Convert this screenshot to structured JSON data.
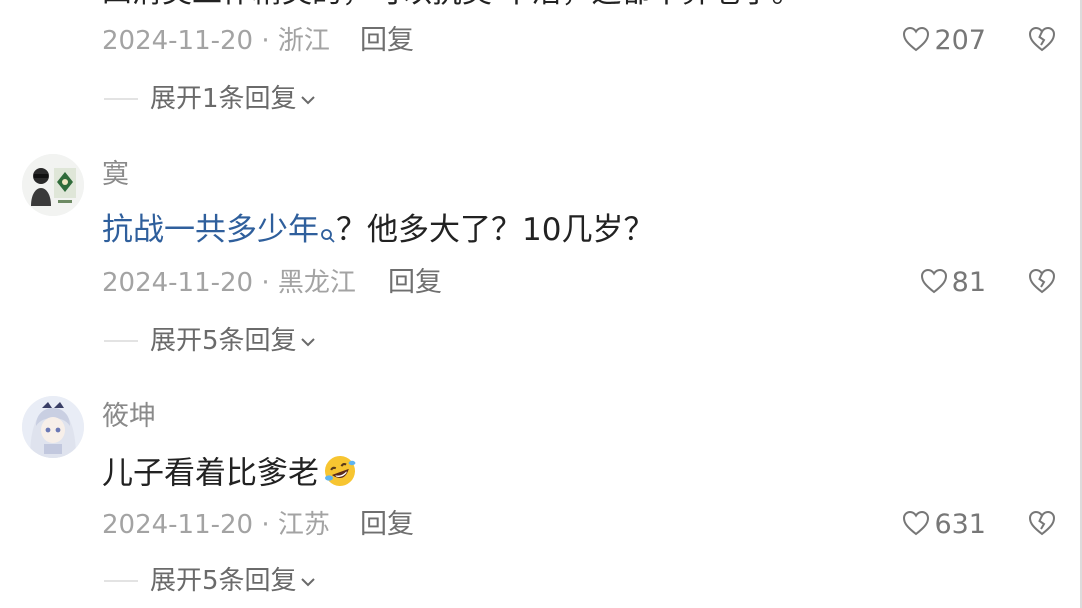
{
  "top_partial": {
    "text": "四清类工作精英的，可以抗美 不活，这都不算老了。"
  },
  "comments": [
    {
      "id": "c0",
      "date_location": "2024-11-20 · 浙江",
      "reply_label": "回复",
      "like_count": "207",
      "expand_label": "展开1条回复"
    },
    {
      "id": "c1",
      "username": "寞",
      "content_link": "抗战一共多少年",
      "content_rest": "？他多大了？10几岁？",
      "date_location": "2024-11-20 · 黑龙江",
      "reply_label": "回复",
      "like_count": "81",
      "expand_label": "展开5条回复"
    },
    {
      "id": "c2",
      "username": "筱坤",
      "content": "儿子看着比爹老",
      "emoji": "rolling-on-floor-laughing",
      "date_location": "2024-11-20 · 江苏",
      "reply_label": "回复",
      "like_count": "631",
      "expand_label": "展开5条回复"
    }
  ],
  "colors": {
    "link": "#2f5f9c",
    "meta": "#a3a3a3",
    "text": "#222222"
  },
  "icons": {
    "like": "heart-outline-icon",
    "dislike": "broken-heart-outline-icon",
    "expand": "chevron-down-icon",
    "search": "search-icon",
    "emoji": "laughing-emoji-icon"
  }
}
